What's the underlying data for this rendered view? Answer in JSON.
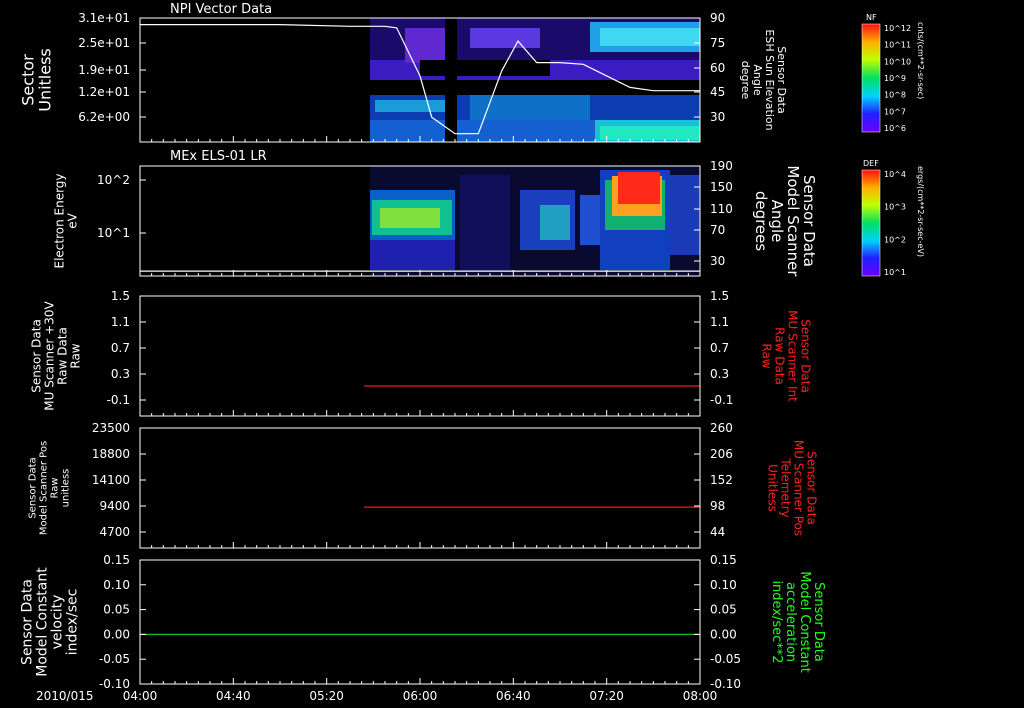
{
  "date_label": "2010/015",
  "time_ticks": [
    "04:00",
    "04:40",
    "05:20",
    "06:00",
    "06:40",
    "07:20",
    "08:00"
  ],
  "colorbars": [
    {
      "title": "NF",
      "units": "cnts/(cm**2-sr-sec)",
      "ticks": [
        "10^12",
        "10^11",
        "10^10",
        "10^9",
        "10^8",
        "10^7",
        "10^6"
      ]
    },
    {
      "title": "DEF",
      "units": "ergs/(cm**2-sr-sec-eV)",
      "ticks": [
        "10^4",
        "10^3",
        "10^2",
        "10^1"
      ]
    }
  ],
  "chart_data": [
    {
      "type": "heatmap",
      "title": "NPI Vector Data",
      "ylabel": [
        "Sector",
        "Unitless"
      ],
      "yticks": [
        "3.1e+01",
        "2.5e+01",
        "1.9e+01",
        "1.2e+01",
        "6.2e+00"
      ],
      "y2label": [
        "Sensor Data",
        "ESH Sun Elevation",
        "Angle",
        "degree"
      ],
      "y2ticks": [
        "90",
        "75",
        "60",
        "45",
        "30"
      ],
      "y2lim": [
        15,
        90
      ],
      "x": [
        "04:00",
        "05:00",
        "05:30",
        "05:45",
        "05:50",
        "06:00",
        "06:05",
        "06:15",
        "06:25",
        "06:35",
        "06:42",
        "06:50",
        "07:00",
        "07:10",
        "07:20",
        "07:30",
        "07:40",
        "08:00"
      ],
      "series": [
        {
          "values": [
            86,
            86,
            85,
            85,
            84,
            55,
            30,
            20,
            20,
            58,
            76,
            63,
            63,
            62,
            55,
            48,
            46,
            46
          ]
        }
      ]
    },
    {
      "type": "heatmap",
      "title": "MEx ELS-01 LR",
      "ylabel": [
        "Electron Energy",
        "eV"
      ],
      "yticks": [
        "10^2",
        "10^1"
      ],
      "y2label": [
        "Sensor Data",
        "Model Scanner",
        "Angle",
        "degrees"
      ],
      "y2ticks": [
        "190",
        "150",
        "110",
        "70",
        "30"
      ],
      "y2lim": [
        0,
        190
      ],
      "x": [
        "04:00",
        "08:00"
      ],
      "series": [
        {
          "values": [
            5,
            5
          ]
        }
      ]
    },
    {
      "type": "line",
      "ylabel": [
        "Sensor Data",
        "MU Scanner +30V",
        "Raw Data",
        "Raw"
      ],
      "yticks": [
        "1.5",
        "1.1",
        "0.7",
        "0.3",
        "-0.1"
      ],
      "y2label": [
        "Sensor Data",
        "MU Scanner Int",
        "Raw Data",
        "Raw"
      ],
      "y2ticks": [
        "1.5",
        "1.1",
        "0.7",
        "0.3",
        "-0.1"
      ],
      "ylim": [
        -0.5,
        1.5
      ],
      "color": "#e02020",
      "x": [
        "05:36",
        "08:00"
      ],
      "series": [
        {
          "values": [
            0.0,
            0.0
          ]
        }
      ]
    },
    {
      "type": "line",
      "ylabel": [
        "Sensor Data",
        "Model Scanner Pos",
        "Raw",
        "unitless"
      ],
      "yticks": [
        "23500",
        "18800",
        "14100",
        "9400",
        "4700"
      ],
      "y2label": [
        "Sensor Data",
        "MU Scanner Pos",
        "Telemetry",
        "Unitless"
      ],
      "y2ticks": [
        "260",
        "206",
        "152",
        "98",
        "44"
      ],
      "ylim": [
        0,
        23500
      ],
      "color": "#e02020",
      "x": [
        "05:36",
        "08:00"
      ],
      "series": [
        {
          "values": [
            8000,
            8000
          ]
        }
      ]
    },
    {
      "type": "line",
      "ylabel": [
        "Sensor Data",
        "Model Constant",
        "velocity",
        "index/sec"
      ],
      "yticks": [
        "0.15",
        "0.10",
        "0.05",
        "0.00",
        "-0.05",
        "-0.10"
      ],
      "y2label": [
        "Sensor Data",
        "Model Constant",
        "acceleration",
        "index/sec**2"
      ],
      "y2ticks": [
        "0.15",
        "0.10",
        "0.05",
        "0.00",
        "-0.05",
        "-0.10"
      ],
      "ylim": [
        -0.1,
        0.15
      ],
      "color": "#20c020",
      "x": [
        "04:00",
        "08:00"
      ],
      "series": [
        {
          "values": [
            0.0,
            0.0
          ]
        }
      ]
    }
  ]
}
